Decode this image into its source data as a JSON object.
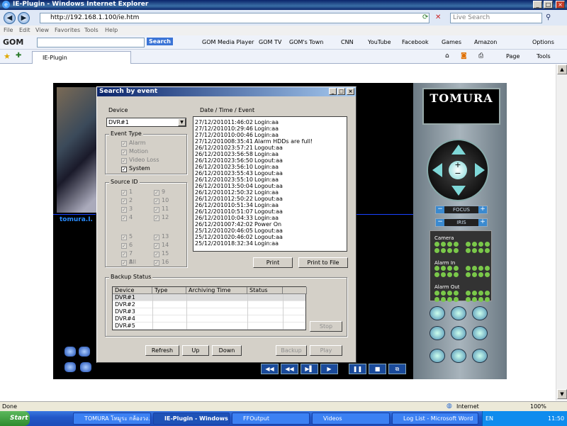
{
  "window": {
    "title": "IE-Plugin - Windows Internet Explorer"
  },
  "address": {
    "url": "http://192.168.1.100/ie.htm",
    "search_placeholder": "Live Search"
  },
  "menu": [
    "File",
    "Edit",
    "View",
    "Favorites",
    "Tools",
    "Help"
  ],
  "toolbar": {
    "search_label": "Search",
    "items": [
      "GOM Media Player",
      "GOM TV",
      "GOM's Town",
      "CNN",
      "YouTube",
      "Facebook",
      "Games",
      "Amazon"
    ],
    "options": "Options"
  },
  "tab": {
    "title": "IE-Plugin",
    "page_menu": "Page",
    "tools_menu": "Tools"
  },
  "dvr": {
    "camera_label": "tomura.I.",
    "logo": "TOMURA",
    "focus": "FOCUS",
    "iris": "IRIS",
    "camera": "Camera",
    "alarm_in": "Alarm In",
    "alarm_out": "Alarm Out"
  },
  "dialog": {
    "title": "Search by event",
    "device_label": "Device",
    "device_value": "DVR#1",
    "datetime_label": "Date / Time / Event",
    "event_type": {
      "title": "Event Type",
      "items": [
        {
          "label": "Alarm",
          "checked": true,
          "enabled": false
        },
        {
          "label": "Motion",
          "checked": true,
          "enabled": false
        },
        {
          "label": "Video Loss",
          "checked": true,
          "enabled": false
        },
        {
          "label": "System",
          "checked": true,
          "enabled": true
        }
      ]
    },
    "source_id": {
      "title": "Source ID",
      "left": [
        "1",
        "2",
        "3",
        "4",
        "5",
        "6",
        "7",
        "8"
      ],
      "right": [
        "9",
        "10",
        "11",
        "12",
        "13",
        "14",
        "15",
        "16"
      ],
      "all": "All"
    },
    "events": [
      {
        "date": "27/12/2010",
        "time": "11:46:02",
        "event": "Login:aa"
      },
      {
        "date": "27/12/2010",
        "time": "10:29:46",
        "event": "Login:aa"
      },
      {
        "date": "27/12/2010",
        "time": "10:00:46",
        "event": "Login:aa"
      },
      {
        "date": "27/12/2010",
        "time": "08:35:41",
        "event": "Alarm HDDs are full!"
      },
      {
        "date": "26/12/2010",
        "time": "23:57:21",
        "event": "Logout:aa"
      },
      {
        "date": "26/12/2010",
        "time": "23:56:58",
        "event": "Login:aa"
      },
      {
        "date": "26/12/2010",
        "time": "23:56:50",
        "event": "Logout:aa"
      },
      {
        "date": "26/12/2010",
        "time": "23:56:10",
        "event": "Login:aa"
      },
      {
        "date": "26/12/2010",
        "time": "23:55:43",
        "event": "Logout:aa"
      },
      {
        "date": "26/12/2010",
        "time": "23:55:10",
        "event": "Login:aa"
      },
      {
        "date": "26/12/2010",
        "time": "13:50:04",
        "event": "Logout:aa"
      },
      {
        "date": "26/12/2010",
        "time": "12:50:32",
        "event": "Login:aa"
      },
      {
        "date": "26/12/2010",
        "time": "12:50:22",
        "event": "Logout:aa"
      },
      {
        "date": "26/12/2010",
        "time": "10:51:34",
        "event": "Login:aa"
      },
      {
        "date": "26/12/2010",
        "time": "10:51:07",
        "event": "Logout:aa"
      },
      {
        "date": "26/12/2010",
        "time": "10:04:33",
        "event": "Login:aa"
      },
      {
        "date": "26/12/2010",
        "time": "07:42:02",
        "event": "Power On"
      },
      {
        "date": "25/12/2010",
        "time": "20:46:05",
        "event": "Logout:aa"
      },
      {
        "date": "25/12/2010",
        "time": "20:46:02",
        "event": "Logout:aa"
      },
      {
        "date": "25/12/2010",
        "time": "18:32:34",
        "event": "Login:aa"
      }
    ],
    "print": "Print",
    "print_to_file": "Print to File",
    "backup_status": "Backup Status",
    "columns": [
      "Device Name",
      "Type",
      "Archiving Time",
      "Status"
    ],
    "backup_rows": [
      "DVR#1",
      "DVR#2",
      "DVR#3",
      "DVR#4",
      "DVR#5"
    ],
    "stop": "Stop",
    "refresh": "Refresh",
    "up": "Up",
    "down": "Down",
    "backup": "Backup",
    "play": "Play"
  },
  "status": {
    "left": "Done",
    "zone": "Internet",
    "zoom": "100%"
  },
  "taskbar": {
    "start": "Start",
    "tasks": [
      "TOMURA โทมูระ กล้องวง...",
      "IE-Plugin - Windows I...",
      "FFOutput",
      "Videos",
      "Log List - Microsoft Word"
    ],
    "lang": "EN",
    "clock": "11:50"
  }
}
